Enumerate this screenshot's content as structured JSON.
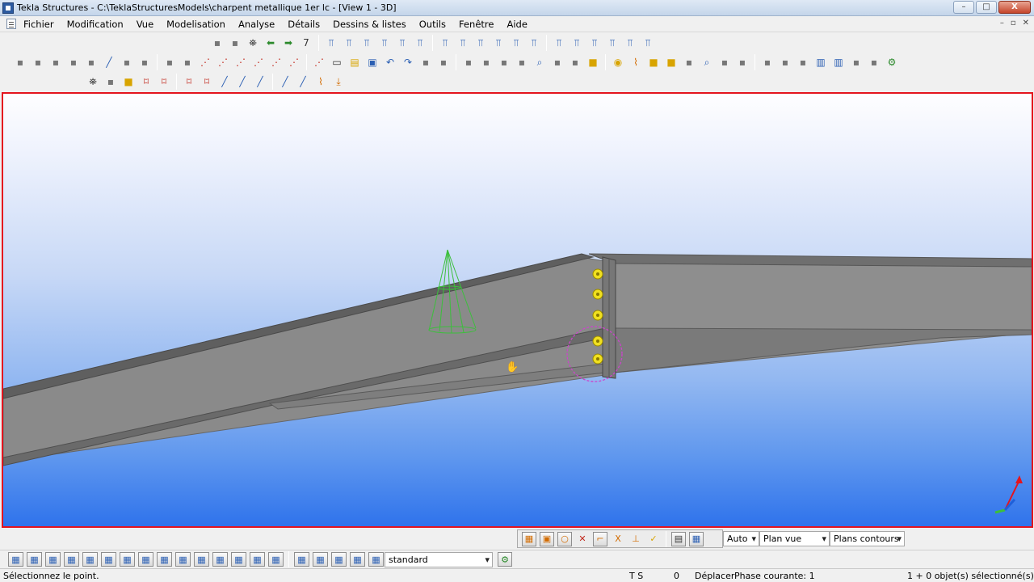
{
  "window": {
    "title": "Tekla Structures - C:\\TeklaStructuresModels\\charpent metallique 1er lc - [View 1 - 3D]",
    "minimize": "–",
    "maximize": "□",
    "close": "X"
  },
  "menu": {
    "items": [
      "Fichier",
      "Modification",
      "Vue",
      "Modelisation",
      "Analyse",
      "Détails",
      "Dessins & listes",
      "Outils",
      "Fenêtre",
      "Aide"
    ],
    "mdi_minimize": "–",
    "mdi_restore": "▫",
    "mdi_close": "✕"
  },
  "toolbar_row1_icons": [
    "align-icon",
    "grid-icon",
    "binoculars-icon",
    "arrow-left-icon",
    "arrow-right-icon",
    "number7-icon",
    "profile-beam-icon",
    "profile-column-icon",
    "profile-plate-icon",
    "profile-truss-icon",
    "profile-purlin-icon",
    "profile-channel-icon",
    "profile-angle-icon",
    "profile-tee-icon",
    "profile-zee-icon",
    "profile-pipe-icon",
    "profile-box-icon",
    "profile-brace-icon",
    "profile-stiff-icon",
    "profile-joist-icon",
    "profile-rafter-icon",
    "profile-girt-icon",
    "profile-sag-icon",
    "profile-flag-icon"
  ],
  "toolbar_row2_icons": [
    "select-all-icon",
    "select-part-icon",
    "beam-icon",
    "column-icon",
    "polybeam-icon",
    "curved-beam-icon",
    "contour-plate-icon",
    "cut-icon",
    "fitting-icon",
    "chamfer-icon",
    "point-icon",
    "point-on-line-icon",
    "point-ext-icon",
    "point-intersect-icon",
    "point-offset-icon",
    "point-arc-icon",
    "point-circle-icon",
    "new-icon",
    "open-icon",
    "save-icon",
    "undo-icon",
    "redo-icon",
    "copy-icon",
    "move-icon",
    "clone-icon",
    "filter-icon",
    "window-icon",
    "view-icon",
    "zoom-icon",
    "rotate-icon",
    "pan-icon",
    "component-icon",
    "bolt-icon",
    "weld-icon",
    "assembly-icon",
    "cast-unit-icon",
    "explode-icon",
    "inquire-icon",
    "measure-icon",
    "dimension-icon",
    "angle-dim-icon",
    "clash-icon",
    "numbering-icon",
    "drawing-icon",
    "report-icon",
    "export-icon",
    "import-icon",
    "settings-icon"
  ],
  "toolbar_row3_icons": [
    "binoculars2-icon",
    "work-plane-icon",
    "box-icon",
    "snap-ref-icon",
    "snap-geom-icon",
    "snap-mid-icon",
    "snap-any-icon",
    "line-tool-icon",
    "dash-tool-icon",
    "arc-tool-icon",
    "curve-tool-icon",
    "slash-tool-icon",
    "weld-prep-icon",
    "anchor-icon"
  ],
  "viewport": {
    "name": "View 1 - 3D",
    "bolt_count": 5
  },
  "snap_toolbar": {
    "icons": [
      "snap-ref-lines-icon",
      "snap-geom-lines-icon",
      "snap-points-icon",
      "snap-cancel-icon",
      "snap-ortho-icon",
      "snap-intersect-icon",
      "snap-perp-icon",
      "snap-ok-icon",
      "snap-plane-icon",
      "snap-grid-icon"
    ],
    "auto_value": "Auto",
    "plane_value": "Plan vue",
    "contour_value": "Plans contours"
  },
  "select_toolbar": {
    "icons": [
      "sel-all-icon",
      "sel-points-icon",
      "sel-grid-icon",
      "sel-gridlines-icon",
      "sel-parts-icon",
      "sel-surface-icon",
      "sel-welds-icon",
      "sel-cuts-icon",
      "sel-views-icon",
      "sel-bolts-icon",
      "sel-plane-icon",
      "sel-reference-icon",
      "sel-bolt-group-icon",
      "sel-comp-icon",
      "sel-detail-icon",
      "sel-seam-icon",
      "sel-reinf-icon",
      "sel-assembly-icon",
      "sel-obj-icon",
      "sel-filter-icon",
      "sel-group-icon"
    ],
    "filter_value": "standard"
  },
  "status": {
    "prompt": "Sélectionnez le point.",
    "ts": "T S",
    "zero": "0",
    "mode": "Déplacer",
    "phase": "Phase courante: 1",
    "selection": "1 + 0 objet(s) sélectionné(s)"
  },
  "colors": {
    "viewport_border": "#e4141e",
    "steel": "#8a8a8a",
    "bolt": "#f0e020",
    "cone": "#3cbf3c",
    "handle_circle": "#cc44cc"
  }
}
